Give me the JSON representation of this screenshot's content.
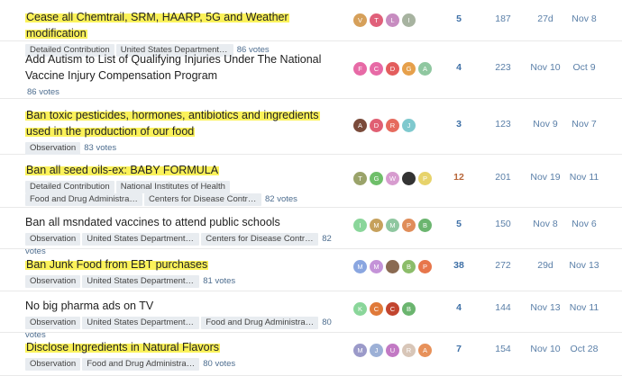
{
  "topics": [
    {
      "title": "Cease all Chemtrail, SRM, HAARP, 5G and Weather modification",
      "highlight": true,
      "tags": [
        "Detailed Contribution",
        "United States Department of ..."
      ],
      "votes": "86 votes",
      "avatars": [
        {
          "letter": "V",
          "color": "#d6a05a"
        },
        {
          "letter": "T",
          "color": "#e0607a"
        },
        {
          "letter": "L",
          "color": "#c78cc0"
        },
        {
          "letter": "I",
          "color": "#a7b3a0"
        }
      ],
      "replies": "5",
      "views": "187",
      "created": "27d",
      "last": "Nov 8"
    },
    {
      "title": "Add Autism to List of Qualifying Injuries Under The National Vaccine Injury Compensation Program",
      "highlight": false,
      "tags": [],
      "votes": "86 votes",
      "avatars": [
        {
          "letter": "F",
          "color": "#e76aa6"
        },
        {
          "letter": "C",
          "color": "#e76aa6"
        },
        {
          "letter": "D",
          "color": "#e35d5d"
        },
        {
          "letter": "G",
          "color": "#e6a04b"
        },
        {
          "letter": "A",
          "color": "#8fc7a0"
        }
      ],
      "replies": "4",
      "views": "223",
      "created": "Nov 10",
      "last": "Oct 9"
    },
    {
      "title": "Ban toxic pesticides, hormones, antibiotics and ingredients used in the production of our food",
      "highlight": true,
      "tags": [
        "Observation"
      ],
      "votes": "83 votes",
      "avatars": [
        {
          "letter": "A",
          "color": "#7a4a3a"
        },
        {
          "letter": "D",
          "color": "#e05f73"
        },
        {
          "letter": "R",
          "color": "#e66b5e"
        },
        {
          "letter": "J",
          "color": "#7fc9ce"
        }
      ],
      "replies": "3",
      "views": "123",
      "created": "Nov 9",
      "last": "Nov 7"
    },
    {
      "title": "Ban all seed oils-ex: BABY FORMULA",
      "highlight": true,
      "tags": [
        "Detailed Contribution",
        "National Institutes of Health",
        "Food and Drug Administration",
        "Centers for Disease Control a..."
      ],
      "votes": "82 votes",
      "avatars": [
        {
          "letter": "T",
          "color": "#9aa36a"
        },
        {
          "letter": "G",
          "color": "#6fbf6a"
        },
        {
          "letter": "W",
          "color": "#d79ccf"
        },
        {
          "letter": "",
          "color": "#333333"
        },
        {
          "letter": "P",
          "color": "#e7d36b"
        }
      ],
      "replies": "12",
      "views": "201",
      "created": "Nov 19",
      "last": "Nov 11"
    },
    {
      "title": "Ban all msndated vaccines to attend public schools",
      "highlight": false,
      "tags": [
        "Observation",
        "United States Department of ...",
        "Centers for Disease Control a..."
      ],
      "votes": "82 votes",
      "avatars": [
        {
          "letter": "I",
          "color": "#8ad69a"
        },
        {
          "letter": "M",
          "color": "#c6a15c"
        },
        {
          "letter": "M",
          "color": "#8fc7a0"
        },
        {
          "letter": "P",
          "color": "#e08d5a"
        },
        {
          "letter": "B",
          "color": "#6bb56f"
        }
      ],
      "replies": "5",
      "views": "150",
      "created": "Nov 8",
      "last": "Nov 6"
    },
    {
      "title": "Ban Junk Food from EBT purchases",
      "highlight": true,
      "tags": [
        "Observation",
        "United States Department of ..."
      ],
      "votes": "81 votes",
      "avatars": [
        {
          "letter": "M",
          "color": "#8aa6e0"
        },
        {
          "letter": "M",
          "color": "#c493d8"
        },
        {
          "letter": "",
          "color": "#8a6a52"
        },
        {
          "letter": "B",
          "color": "#8cbd6a"
        },
        {
          "letter": "P",
          "color": "#e7764b"
        }
      ],
      "replies": "38",
      "views": "272",
      "created": "29d",
      "last": "Nov 13"
    },
    {
      "title": "No big pharma ads on TV",
      "highlight": false,
      "tags": [
        "Observation",
        "United States Department of ...",
        "Food and Drug Administration"
      ],
      "votes": "80 votes",
      "avatars": [
        {
          "letter": "K",
          "color": "#8ad69a"
        },
        {
          "letter": "C",
          "color": "#e07a3a"
        },
        {
          "letter": "C",
          "color": "#c2452f"
        },
        {
          "letter": "B",
          "color": "#6bb56f"
        }
      ],
      "replies": "4",
      "views": "144",
      "created": "Nov 13",
      "last": "Nov 11"
    },
    {
      "title": "Disclose Ingredients in Natural Flavors",
      "highlight": true,
      "tags": [
        "Observation",
        "Food and Drug Administration"
      ],
      "votes": "80 votes",
      "avatars": [
        {
          "letter": "M",
          "color": "#9b9ac9"
        },
        {
          "letter": "J",
          "color": "#9cb0d6"
        },
        {
          "letter": "U",
          "color": "#c279c4"
        },
        {
          "letter": "R",
          "color": "#d8c6b8"
        },
        {
          "letter": "A",
          "color": "#e7915a"
        }
      ],
      "replies": "7",
      "views": "154",
      "created": "Nov 10",
      "last": "Oct 28"
    }
  ]
}
